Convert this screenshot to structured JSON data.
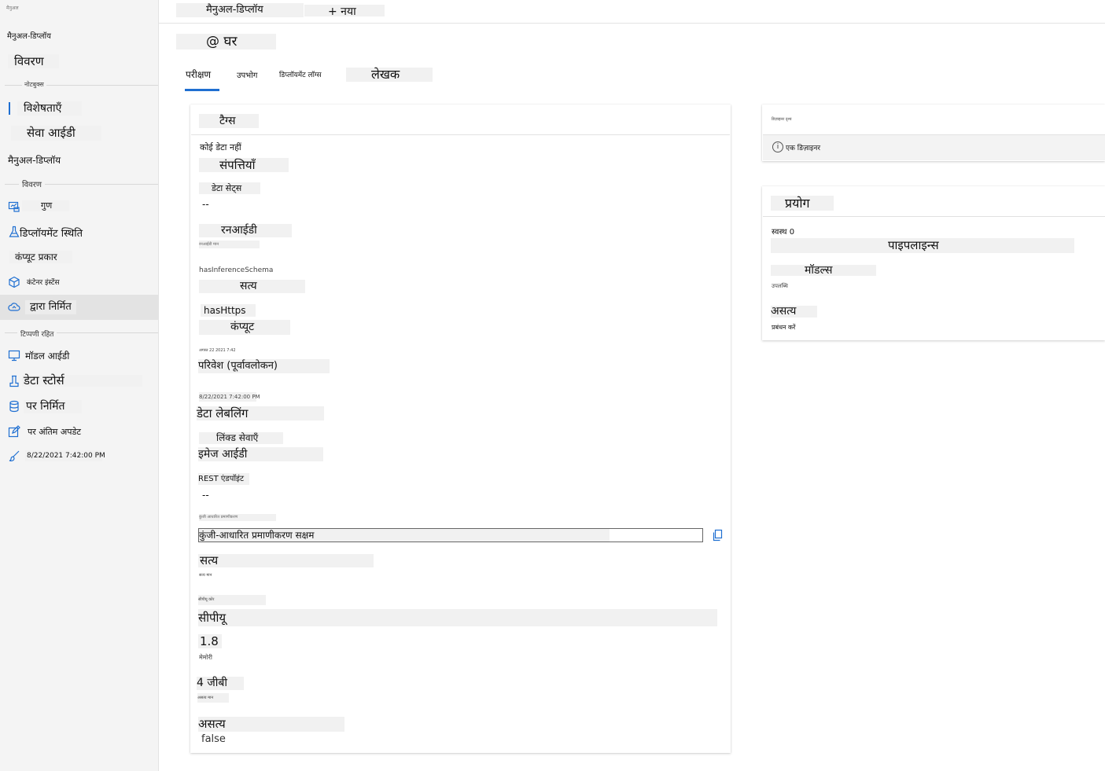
{
  "sidebar": {
    "tiny_header": "मैनुअल",
    "title": "मैनुअल-डिप्लॉय",
    "section_details": "विवरण",
    "group_notebooks": "नोटबुक्स",
    "item_features": "विशेषताएँ",
    "item_service_id": "सेवा आईडी",
    "item_manual_deploy": "मैनुअल-डिप्लॉय",
    "group_details": "विवरण",
    "item_properties": "गुण",
    "item_deploy_status": "डिप्लॉयमेंट स्थिति",
    "item_compute_type": "कंप्यूट प्रकार",
    "item_container_instance": "कंटेनर इंस्टेंस",
    "item_created_by": "द्वारा निर्मित",
    "group_notes": "टिप्पणी रहित",
    "item_model_id": "मॉडल आईडी",
    "item_data_stores": "डेटा स्टोर्स",
    "item_created_on": "पर निर्मित",
    "item_last_update": "पर अंतिम अपडेट",
    "item_timestamp": "8/22/2021 7:42:00 PM"
  },
  "topbar": {
    "breadcrumb": "मैनुअल-डिप्लॉय",
    "new_button": "+ नया"
  },
  "page": {
    "title": "@ घर"
  },
  "tabs": {
    "test": "परीक्षण",
    "consume": "उपभोग",
    "deploy_logs": "डिप्लॉयमेंट लॉग्स",
    "author": "लेखक"
  },
  "main_card": {
    "tags_header": "टैग्स",
    "no_data": "कोई डेटा नहीं",
    "properties_header": "संपत्तियाँ",
    "datasets_label": "डेटा सेट्स",
    "datasets_value": "--",
    "runid_label": "रनआईडी",
    "runid_value_tiny": "रनआईडी मान",
    "has_inference_label": "hasInferenceSchema",
    "has_inference_value": "सत्य",
    "has_https_label": "hasHttps",
    "compute_label": "कंप्यूट",
    "tiny_date": "अगस्त 22 2021 7:42",
    "environment_label": "परिवेश (पूर्वावलोकन)",
    "created_date": "8/22/2021 7:42:00 PM",
    "data_labeling": "डेटा लेबलिंग",
    "linked_services": "लिंक्ड सेवाएँ",
    "image_id": "इमेज आईडी",
    "rest_endpoint_label": "REST एंडपॉइंट",
    "rest_endpoint_value": "--",
    "tiny_auth_label": "कुंजी आधारित प्रमाणीकरण",
    "key_auth_field": "कुंजी-आधारित प्रमाणीकरण सक्षम",
    "true_value": "सत्य",
    "tiny_true": "सत्य मान",
    "tiny_cpu_label": "सीपीयू कोर",
    "cpu_label": "सीपीयू",
    "cpu_value": "1.8",
    "memory_label": "मेमोरी",
    "memory_value": "4 जीबी",
    "tiny_false_label": "असत्य मान",
    "false_label": "असत्य",
    "false_value": "false"
  },
  "right_top_card": {
    "tiny_header": "डिज़ाइनर दृश्य",
    "info_text": "एक डिज़ाइनर"
  },
  "right_card": {
    "header": "प्रयोग",
    "status_text": "स्वस्थ 0",
    "pipelines": "पाइपलाइन्स",
    "models": "मॉडल्स",
    "tiny_text": "उपलब्धि",
    "false_label": "असत्य",
    "manage_text": "प्रबंधन करें"
  },
  "icons": {
    "properties": "chart-icon",
    "deploy_status": "flask-icon",
    "container": "cube-icon",
    "created_by": "cloud-icon",
    "model": "monitor-icon",
    "data_stores": "beaker-icon",
    "created_on": "database-icon",
    "last_update": "edit-icon",
    "timestamp": "brush-icon",
    "copy": "copy-icon",
    "info": "info-icon"
  },
  "colors": {
    "accent": "#1f6fd1",
    "sidebar_bg": "#f4f4f4",
    "highlight": "#f1f1f1"
  }
}
